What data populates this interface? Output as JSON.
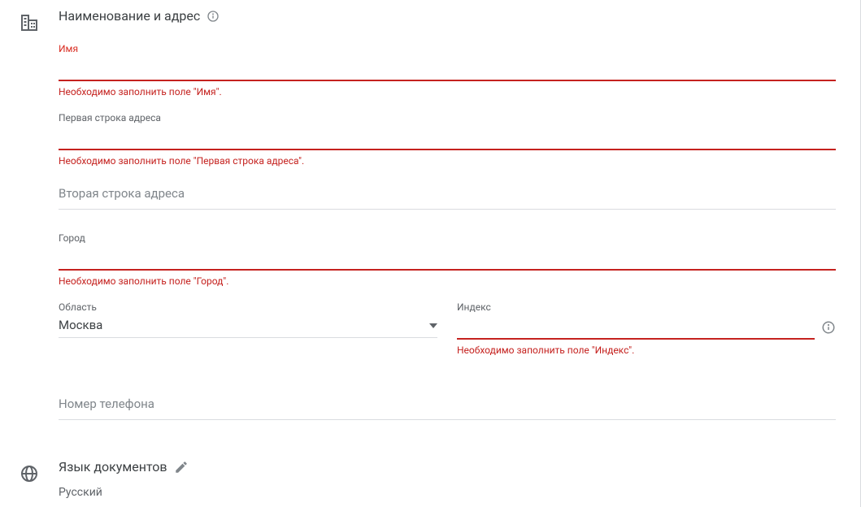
{
  "nameAddress": {
    "title": "Наименование и адрес",
    "fields": {
      "name": {
        "label": "Имя",
        "value": "",
        "error": "Необходимо заполнить поле \"Имя\"."
      },
      "address1": {
        "label": "Первая строка адреса",
        "value": "",
        "error": "Необходимо заполнить поле \"Первая строка адреса\"."
      },
      "address2": {
        "placeholder": "Вторая строка адреса",
        "value": ""
      },
      "city": {
        "label": "Город",
        "value": "",
        "error": "Необходимо заполнить поле \"Город\"."
      },
      "region": {
        "label": "Область",
        "value": "Москва"
      },
      "postal": {
        "label": "Индекс",
        "value": "",
        "error": "Необходимо заполнить поле \"Индекс\"."
      },
      "phone": {
        "placeholder": "Номер телефона",
        "value": ""
      }
    }
  },
  "docLanguage": {
    "title": "Язык документов",
    "value": "Русский"
  }
}
